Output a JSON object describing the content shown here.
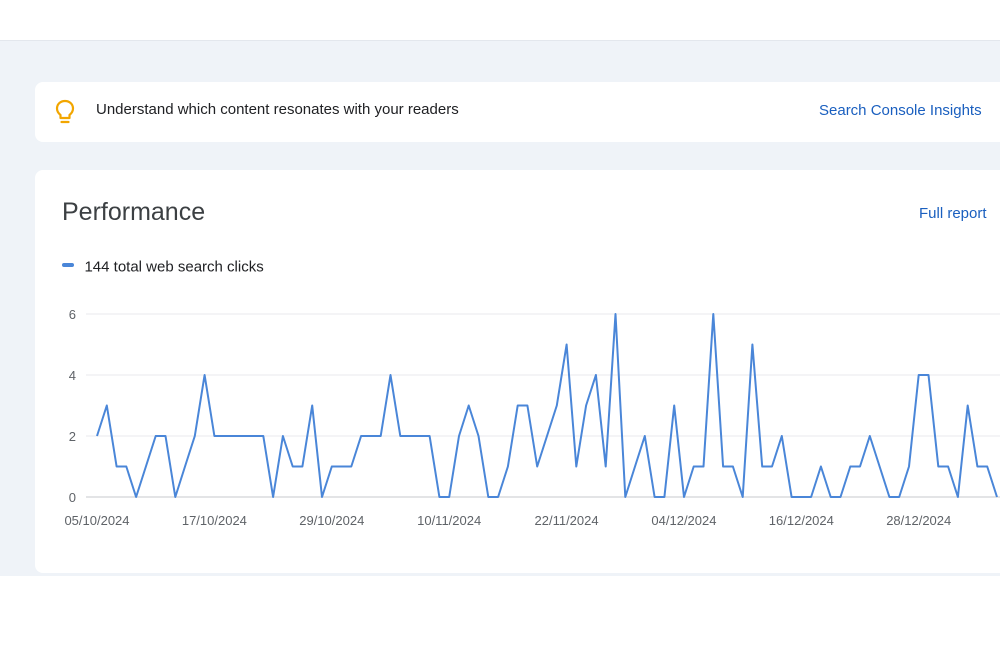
{
  "insight_banner": {
    "text": "Understand which content resonates with your readers",
    "link_label": "Search Console Insights",
    "icon": "lightbulb-icon",
    "icon_color": "#f2a600"
  },
  "performance": {
    "title": "Performance",
    "full_report_label": "Full report",
    "legend_label": "144 total web search clicks",
    "series_color": "#4a86d8"
  },
  "chart_data": {
    "type": "line",
    "x_tick_labels": [
      "05/10/2024",
      "17/10/2024",
      "29/10/2024",
      "10/11/2024",
      "22/11/2024",
      "04/12/2024",
      "16/12/2024",
      "28/12/2024"
    ],
    "y_ticks": [
      0,
      2,
      4,
      6
    ],
    "ylim": [
      0,
      6
    ],
    "grid": true,
    "series": [
      {
        "name": "144 total web search clicks",
        "x_start": "05/10/2024",
        "values": [
          2,
          3,
          1,
          1,
          0,
          1,
          2,
          2,
          0,
          1,
          2,
          4,
          2,
          2,
          2,
          2,
          2,
          2,
          0,
          2,
          1,
          1,
          3,
          0,
          1,
          1,
          1,
          2,
          2,
          2,
          4,
          2,
          2,
          2,
          2,
          0,
          0,
          2,
          3,
          2,
          0,
          0,
          1,
          3,
          3,
          1,
          2,
          3,
          5,
          1,
          3,
          4,
          1,
          6,
          0,
          1,
          2,
          0,
          0,
          3,
          0,
          1,
          1,
          6,
          1,
          1,
          0,
          5,
          1,
          1,
          2,
          0,
          0,
          0,
          1,
          0,
          0,
          1,
          1,
          2,
          1,
          0,
          0,
          1,
          4,
          4,
          1,
          1,
          0,
          3,
          1,
          1,
          0
        ]
      }
    ]
  }
}
